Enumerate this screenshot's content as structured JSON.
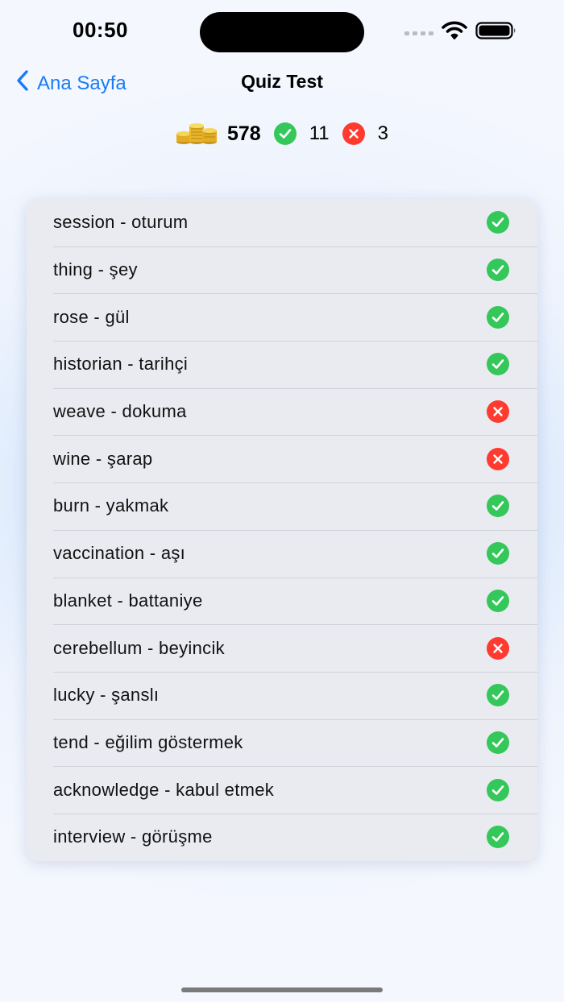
{
  "status_bar": {
    "time": "00:50"
  },
  "nav": {
    "back_label": "Ana Sayfa",
    "title": "Quiz Test"
  },
  "stats": {
    "coins": "578",
    "correct": "11",
    "wrong": "3"
  },
  "colors": {
    "accent": "#1a7cf5",
    "correct": "#34c759",
    "wrong": "#ff3b30"
  },
  "results": [
    {
      "label": "session - oturum",
      "correct": true
    },
    {
      "label": "thing - şey",
      "correct": true
    },
    {
      "label": "rose - gül",
      "correct": true
    },
    {
      "label": "historian - tarihçi",
      "correct": true
    },
    {
      "label": "weave - dokuma",
      "correct": false
    },
    {
      "label": "wine - şarap",
      "correct": false
    },
    {
      "label": "burn - yakmak",
      "correct": true
    },
    {
      "label": "vaccination - aşı",
      "correct": true
    },
    {
      "label": "blanket - battaniye",
      "correct": true
    },
    {
      "label": "cerebellum - beyincik",
      "correct": false
    },
    {
      "label": "lucky - şanslı",
      "correct": true
    },
    {
      "label": "tend - eğilim göstermek",
      "correct": true
    },
    {
      "label": "acknowledge - kabul etmek",
      "correct": true
    },
    {
      "label": "interview - görüşme",
      "correct": true
    }
  ]
}
